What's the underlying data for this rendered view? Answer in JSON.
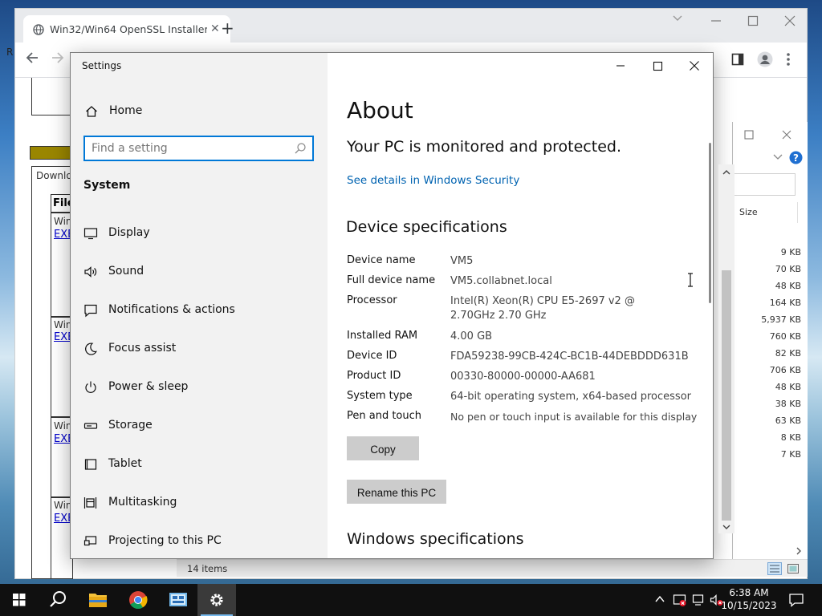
{
  "browser": {
    "tab_title": "Win32/Win64 OpenSSL Installer",
    "tab_close": "✕",
    "new_tab": "+",
    "left_panel": {
      "download_label": "Downlo",
      "file_header": "File",
      "rows": [
        {
          "name": "Win",
          "link": "EXE"
        },
        {
          "name": "Win",
          "link": "EXE"
        },
        {
          "name": "Win",
          "link": "EXE"
        },
        {
          "name": "Win",
          "link": "EXE"
        }
      ]
    },
    "left_edge_char": "R"
  },
  "explorer": {
    "size_header": "Size",
    "sizes": [
      "9 KB",
      "70 KB",
      "48 KB",
      "164 KB",
      "5,937 KB",
      "760 KB",
      "82 KB",
      "706 KB",
      "48 KB",
      "38 KB",
      "63 KB",
      "8 KB",
      "7 KB"
    ],
    "status": "14 items"
  },
  "settings": {
    "window_title": "Settings",
    "home": "Home",
    "search_placeholder": "Find a setting",
    "section": "System",
    "nav": [
      {
        "label": "Display",
        "icon": "display-icon"
      },
      {
        "label": "Sound",
        "icon": "speaker-icon"
      },
      {
        "label": "Notifications & actions",
        "icon": "notification-icon"
      },
      {
        "label": "Focus assist",
        "icon": "moon-icon"
      },
      {
        "label": "Power & sleep",
        "icon": "power-icon"
      },
      {
        "label": "Storage",
        "icon": "storage-icon"
      },
      {
        "label": "Tablet",
        "icon": "tablet-icon"
      },
      {
        "label": "Multitasking",
        "icon": "multitasking-icon"
      },
      {
        "label": "Projecting to this PC",
        "icon": "projector-icon"
      }
    ],
    "about": {
      "title": "About",
      "protected": "Your PC is monitored and protected.",
      "security_link": "See details in Windows Security",
      "device_spec_heading": "Device specifications",
      "specs": [
        {
          "key": "Device name",
          "value": "VM5"
        },
        {
          "key": "Full device name",
          "value": "VM5.collabnet.local"
        },
        {
          "key": "Processor",
          "value": "Intel(R) Xeon(R) CPU E5-2697 v2 @ 2.70GHz 2.70 GHz"
        },
        {
          "key": "Installed RAM",
          "value": "4.00 GB"
        },
        {
          "key": "Device ID",
          "value": "FDA59238-99CB-424C-BC1B-44DEBDDD631B"
        },
        {
          "key": "Product ID",
          "value": "00330-80000-00000-AA681"
        },
        {
          "key": "System type",
          "value": "64-bit operating system, x64-based processor"
        },
        {
          "key": "Pen and touch",
          "value": "No pen or touch input is available for this display"
        }
      ],
      "copy_button": "Copy",
      "rename_button": "Rename this PC",
      "windows_spec_heading": "Windows specifications"
    }
  },
  "taskbar": {
    "time": "6:38 AM",
    "date": "10/15/2023"
  },
  "colors": {
    "accent": "#0078d7",
    "link": "#0063b1",
    "taskbar": "#101010",
    "sidebar": "#f2f2f2"
  }
}
